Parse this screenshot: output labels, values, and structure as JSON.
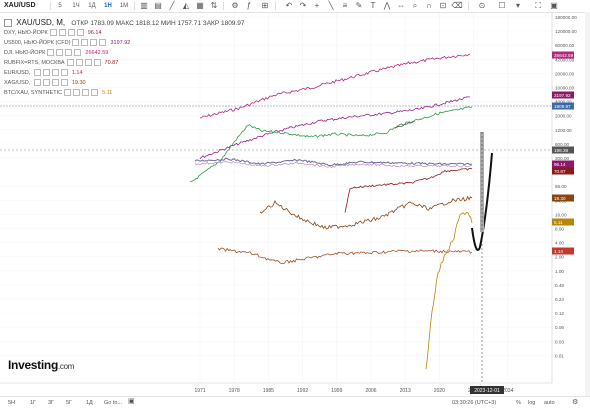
{
  "toolbar": {
    "symbol": "XAU/USD",
    "intervals": [
      "5",
      "1Ч",
      "1Д",
      "1Н",
      "1М"
    ],
    "active_interval": "1Н"
  },
  "legend": {
    "title": "XAU/USD, М, ",
    "ohlc": "ОТКР 1783.09  МАКС 1818.12  МИН 1757.71  ЗАКР 1809.97",
    "overlays": [
      {
        "name": "DXY, НЬЮ-ЙОРК",
        "value": "96.14",
        "color": "#8b1a6b"
      },
      {
        "name": "US500, НЬЮ-ЙОРК (CFD)",
        "value": "3197.92",
        "color": "#8b1a6b"
      },
      {
        "name": "DJI, НЬЮ-ЙОРК",
        "value": "26642.59",
        "color": "#b5267a"
      },
      {
        "name": "RUBFIX=RTS, МОСКВА",
        "value": "70.87",
        "color": "#8b1a1a"
      },
      {
        "name": "EUR/USD, ",
        "value": "1.14",
        "color": "#c0392b"
      },
      {
        "name": "XAG/USD, ",
        "value": "19.30",
        "color": "#8b4513"
      },
      {
        "name": "BTC/XAU, SYNTHETIC",
        "value": "5.11",
        "color": "#b8860b"
      }
    ]
  },
  "price_axis": {
    "ticks": [
      "180000.00",
      "120000.00",
      "80000.00",
      "42000.00",
      "20000.00",
      "10000.00",
      "4000.00",
      "2000.00",
      "1200.00",
      "600.00",
      "300.00",
      "140.00",
      "66.00",
      "34.00",
      "16.00",
      "8.00",
      "4.00",
      "2.00",
      "1.00",
      "0.48",
      "0.24",
      "0.12",
      "0.06",
      "0.03",
      "0.01"
    ],
    "labels": [
      {
        "text": "26642.59",
        "color": "#b5267a"
      },
      {
        "text": "3197.92",
        "color": "#8b1a6b"
      },
      {
        "text": "1809.97",
        "color": "#3a6aa8"
      },
      {
        "text": "198.38",
        "color": "#555555"
      },
      {
        "text": "96.14",
        "color": "#8b1a6b"
      },
      {
        "text": "70.87",
        "color": "#8b1a1a"
      },
      {
        "text": "19.30",
        "color": "#8b4513"
      },
      {
        "text": "5.11",
        "color": "#b8860b"
      },
      {
        "text": "1.14",
        "color": "#c0392b"
      }
    ]
  },
  "time_axis": {
    "ticks": [
      "1971",
      "1978",
      "1985",
      "1992",
      "1999",
      "2006",
      "2013",
      "2020",
      "2027",
      "2034"
    ],
    "cursor_label": "2023-12-01"
  },
  "bottom": {
    "ranges": [
      "5Н",
      "1Г",
      "3Г",
      "5Г",
      "1Д",
      "Go to..."
    ],
    "clock": "03:30:26 (UTC+3)",
    "scale": "%",
    "log": "log",
    "auto": "auto"
  },
  "logo": {
    "text": "Investing",
    "suffix": ".com"
  },
  "colors": {
    "cursor": "#333333",
    "baseline": "#6a7fc0"
  }
}
